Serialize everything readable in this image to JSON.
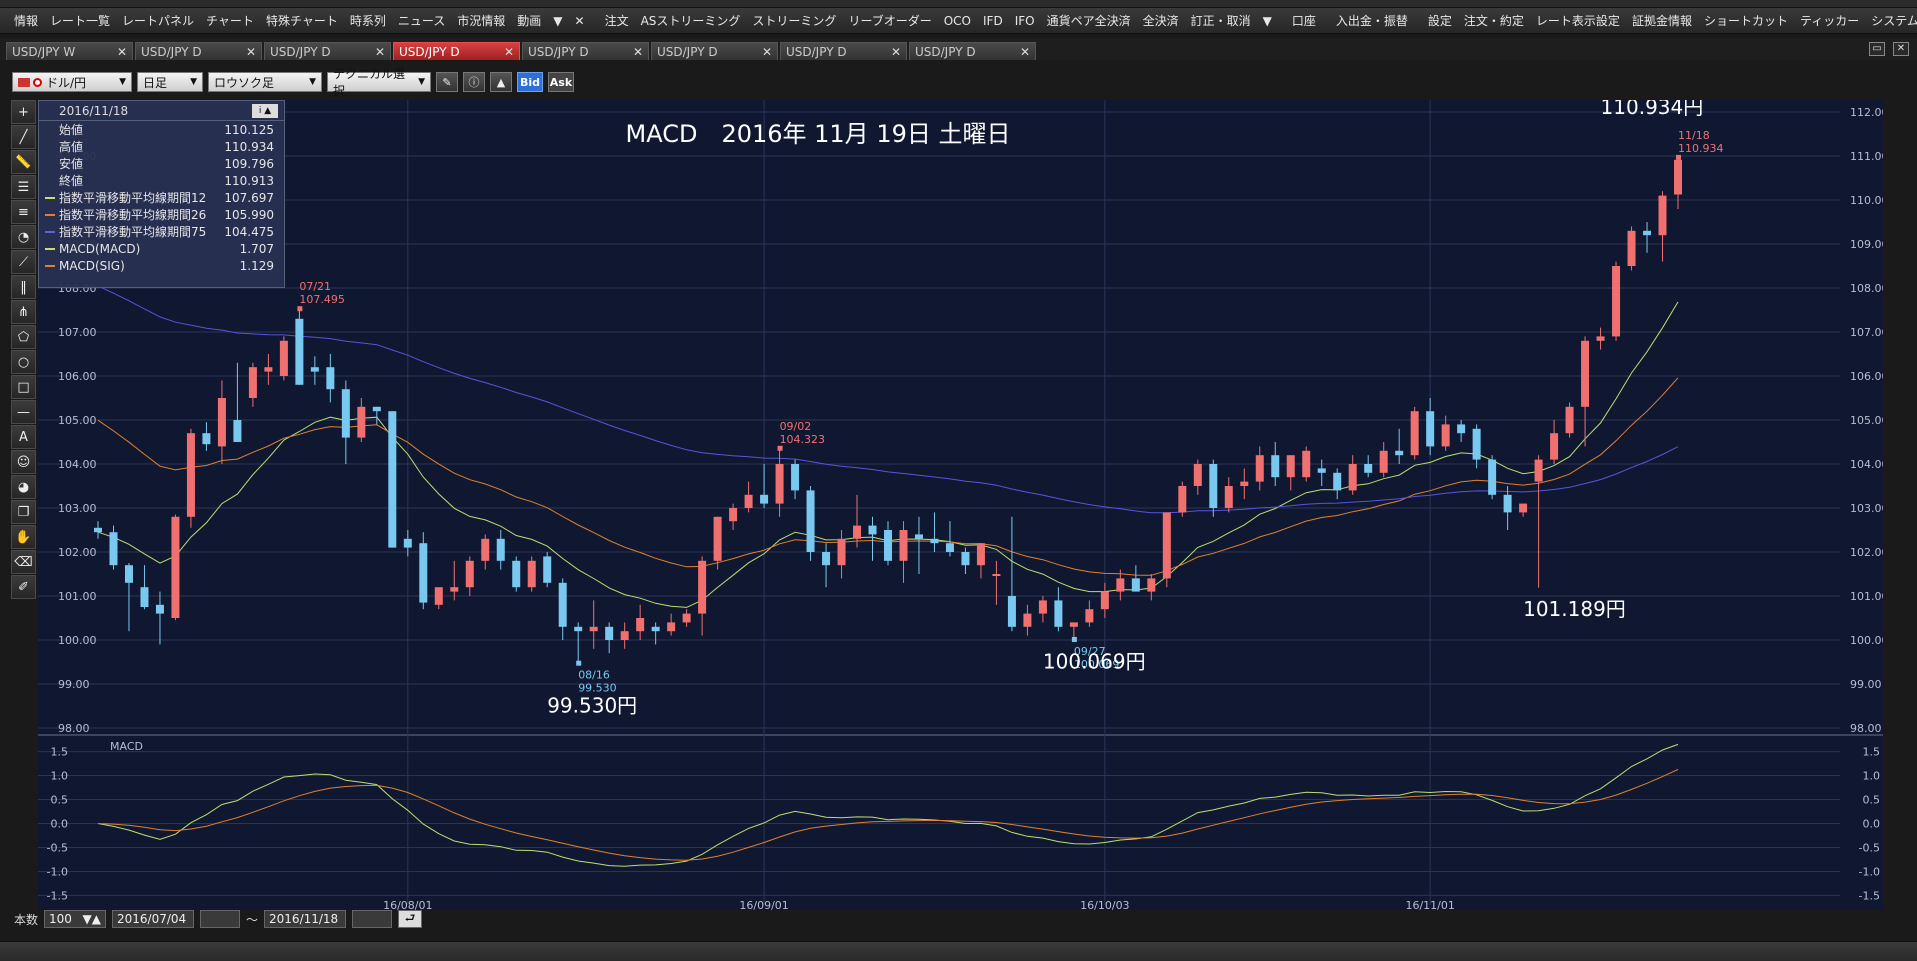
{
  "menubar": {
    "items": [
      "情報",
      "レート一覧",
      "レートパネル",
      "チャート",
      "特殊チャート",
      "時系列",
      "ニュース",
      "市況情報",
      "動画",
      "▼",
      "✕"
    ],
    "items2": [
      "注文",
      "ASストリーミング",
      "ストリーミング",
      "リーブオーダー",
      "OCO",
      "IFD",
      "IFO",
      "通貨ペア全決済",
      "全決済",
      "訂正・取消",
      "▼"
    ],
    "items3": [
      "口座"
    ],
    "items4": [
      "入出金・振替"
    ],
    "items5": [
      "設定",
      "注文・約定",
      "レート表示設定",
      "証拠金情報",
      "ショートカット",
      "ティッカー",
      "システム",
      "画面設定",
      "チャート"
    ]
  },
  "tabs": [
    {
      "label": "USD/JPY W",
      "active": false
    },
    {
      "label": "USD/JPY D",
      "active": false
    },
    {
      "label": "USD/JPY D",
      "active": false
    },
    {
      "label": "USD/JPY D",
      "active": true
    },
    {
      "label": "USD/JPY D",
      "active": false
    },
    {
      "label": "USD/JPY D",
      "active": false
    },
    {
      "label": "USD/JPY D",
      "active": false
    },
    {
      "label": "USD/JPY D",
      "active": false
    }
  ],
  "tab_close": "✕",
  "toolbar": {
    "pair": "ドル/円",
    "period": "日足",
    "style": "ロウソク足",
    "technical": "テクニカル選択",
    "bid": "Bid",
    "ask": "Ask"
  },
  "infopanel": {
    "date": "2016/11/18",
    "rows": [
      {
        "label": "始値",
        "value": "110.125",
        "color": ""
      },
      {
        "label": "高値",
        "value": "110.934",
        "color": ""
      },
      {
        "label": "安値",
        "value": "109.796",
        "color": ""
      },
      {
        "label": "終値",
        "value": "110.913",
        "color": ""
      },
      {
        "label": "指数平滑移動平均線期間12",
        "value": "107.697",
        "color": "#c8e060"
      },
      {
        "label": "指数平滑移動平均線期間26",
        "value": "105.990",
        "color": "#e08030"
      },
      {
        "label": "指数平滑移動平均線期間75",
        "value": "104.475",
        "color": "#6060e0"
      },
      {
        "label": "MACD(MACD)",
        "value": "1.707",
        "color": "#c8e060"
      },
      {
        "label": "MACD(SIG)",
        "value": "1.129",
        "color": "#e08030"
      }
    ]
  },
  "bottombar": {
    "count_label": "本数",
    "count_value": "100",
    "start": "2016/07/04",
    "tilde": "～",
    "end": "2016/11/18"
  },
  "chart_data": {
    "type": "candlestick",
    "title": "MACD　2016年 11月 19日 土曜日",
    "price_axis": {
      "min": 98,
      "max": 112,
      "ticks": [
        "112.00",
        "111.00",
        "110.00",
        "109.00",
        "108.00",
        "107.00",
        "106.00",
        "105.00",
        "104.00",
        "103.00",
        "102.00",
        "101.00",
        "100.00",
        "99.00",
        "98.00"
      ]
    },
    "macd_axis": {
      "min": -1.7,
      "max": 1.7,
      "ticks": [
        "1.5",
        "1.0",
        "0.5",
        "0.0",
        "-0.5",
        "-1.0",
        "-1.5"
      ]
    },
    "macd_label": "MACD",
    "date_ticks": [
      "16/08/01",
      "16/09/01",
      "16/10/03",
      "16/11/01"
    ],
    "candles": [
      {
        "date": "2016/07/04",
        "o": 102.55,
        "h": 102.7,
        "l": 102.3,
        "c": 102.45
      },
      {
        "date": "2016/07/05",
        "o": 102.45,
        "h": 102.6,
        "l": 101.6,
        "c": 101.7
      },
      {
        "date": "2016/07/06",
        "o": 101.7,
        "h": 101.75,
        "l": 100.2,
        "c": 101.3
      },
      {
        "date": "2016/07/07",
        "o": 101.2,
        "h": 101.7,
        "l": 100.7,
        "c": 100.75
      },
      {
        "date": "2016/07/08",
        "o": 100.8,
        "h": 101.1,
        "l": 99.9,
        "c": 100.6
      },
      {
        "date": "2016/07/11",
        "o": 100.5,
        "h": 102.85,
        "l": 100.45,
        "c": 102.8
      },
      {
        "date": "2016/07/12",
        "o": 102.8,
        "h": 104.8,
        "l": 102.55,
        "c": 104.7
      },
      {
        "date": "2016/07/13",
        "o": 104.7,
        "h": 104.95,
        "l": 104.3,
        "c": 104.45
      },
      {
        "date": "2016/07/14",
        "o": 104.4,
        "h": 105.9,
        "l": 104.0,
        "c": 105.5
      },
      {
        "date": "2016/07/15",
        "o": 105.0,
        "h": 106.3,
        "l": 104.8,
        "c": 104.5
      },
      {
        "date": "2016/07/18",
        "o": 105.5,
        "h": 106.3,
        "l": 105.3,
        "c": 106.2
      },
      {
        "date": "2016/07/19",
        "o": 106.1,
        "h": 106.5,
        "l": 105.8,
        "c": 106.2
      },
      {
        "date": "2016/07/20",
        "o": 106.0,
        "h": 106.9,
        "l": 105.9,
        "c": 106.8
      },
      {
        "date": "2016/07/21",
        "o": 107.3,
        "h": 107.495,
        "l": 105.8,
        "c": 105.8
      },
      {
        "date": "2016/07/22",
        "o": 106.2,
        "h": 106.45,
        "l": 105.8,
        "c": 106.1
      },
      {
        "date": "2016/07/25",
        "o": 106.2,
        "h": 106.5,
        "l": 105.4,
        "c": 105.7
      },
      {
        "date": "2016/07/26",
        "o": 105.7,
        "h": 105.9,
        "l": 104.0,
        "c": 104.6
      },
      {
        "date": "2016/07/27",
        "o": 104.6,
        "h": 105.5,
        "l": 104.5,
        "c": 105.3
      },
      {
        "date": "2016/07/28",
        "o": 105.3,
        "h": 105.3,
        "l": 104.9,
        "c": 105.2
      },
      {
        "date": "2016/07/29",
        "o": 105.2,
        "h": 105.2,
        "l": 102.1,
        "c": 102.1
      },
      {
        "date": "2016/08/01",
        "o": 102.3,
        "h": 102.5,
        "l": 101.9,
        "c": 102.1
      },
      {
        "date": "2016/08/02",
        "o": 102.2,
        "h": 102.45,
        "l": 100.7,
        "c": 100.85
      },
      {
        "date": "2016/08/03",
        "o": 100.8,
        "h": 101.0,
        "l": 100.7,
        "c": 101.2
      },
      {
        "date": "2016/08/04",
        "o": 101.1,
        "h": 101.8,
        "l": 100.9,
        "c": 101.2
      },
      {
        "date": "2016/08/05",
        "o": 101.2,
        "h": 101.9,
        "l": 101.0,
        "c": 101.8
      },
      {
        "date": "2016/08/08",
        "o": 101.8,
        "h": 102.4,
        "l": 101.6,
        "c": 102.3
      },
      {
        "date": "2016/08/09",
        "o": 102.3,
        "h": 102.5,
        "l": 101.6,
        "c": 101.8
      },
      {
        "date": "2016/08/10",
        "o": 101.8,
        "h": 101.9,
        "l": 101.1,
        "c": 101.2
      },
      {
        "date": "2016/08/11",
        "o": 101.2,
        "h": 101.9,
        "l": 101.1,
        "c": 101.8
      },
      {
        "date": "2016/08/12",
        "o": 101.9,
        "h": 102.0,
        "l": 101.2,
        "c": 101.3
      },
      {
        "date": "2016/08/15",
        "o": 101.3,
        "h": 101.4,
        "l": 100.0,
        "c": 100.3
      },
      {
        "date": "2016/08/16",
        "o": 100.3,
        "h": 100.4,
        "l": 99.53,
        "c": 100.2
      },
      {
        "date": "2016/08/17",
        "o": 100.2,
        "h": 100.9,
        "l": 99.8,
        "c": 100.3
      },
      {
        "date": "2016/08/18",
        "o": 100.3,
        "h": 100.4,
        "l": 99.7,
        "c": 100.0
      },
      {
        "date": "2016/08/19",
        "o": 100.0,
        "h": 100.4,
        "l": 99.8,
        "c": 100.2
      },
      {
        "date": "2016/08/22",
        "o": 100.2,
        "h": 100.8,
        "l": 100.0,
        "c": 100.5
      },
      {
        "date": "2016/08/23",
        "o": 100.3,
        "h": 100.4,
        "l": 99.9,
        "c": 100.2
      },
      {
        "date": "2016/08/24",
        "o": 100.2,
        "h": 100.6,
        "l": 100.1,
        "c": 100.4
      },
      {
        "date": "2016/08/25",
        "o": 100.4,
        "h": 100.7,
        "l": 100.3,
        "c": 100.6
      },
      {
        "date": "2016/08/26",
        "o": 100.6,
        "h": 101.9,
        "l": 100.1,
        "c": 101.8
      },
      {
        "date": "2016/08/29",
        "o": 101.8,
        "h": 102.8,
        "l": 101.6,
        "c": 102.8
      },
      {
        "date": "2016/08/30",
        "o": 102.7,
        "h": 103.1,
        "l": 102.5,
        "c": 103.0
      },
      {
        "date": "2016/08/31",
        "o": 103.0,
        "h": 103.6,
        "l": 102.9,
        "c": 103.3
      },
      {
        "date": "2016/09/01",
        "o": 103.3,
        "h": 104.0,
        "l": 103.0,
        "c": 103.1
      },
      {
        "date": "2016/09/02",
        "o": 103.1,
        "h": 104.323,
        "l": 102.8,
        "c": 104.0
      },
      {
        "date": "2016/09/05",
        "o": 104.0,
        "h": 104.1,
        "l": 103.2,
        "c": 103.4
      },
      {
        "date": "2016/09/06",
        "o": 103.4,
        "h": 103.5,
        "l": 101.8,
        "c": 102.0
      },
      {
        "date": "2016/09/07",
        "o": 102.0,
        "h": 102.2,
        "l": 101.2,
        "c": 101.7
      },
      {
        "date": "2016/09/08",
        "o": 101.7,
        "h": 102.5,
        "l": 101.4,
        "c": 102.3
      },
      {
        "date": "2016/09/09",
        "o": 102.3,
        "h": 103.3,
        "l": 102.1,
        "c": 102.6
      },
      {
        "date": "2016/09/12",
        "o": 102.6,
        "h": 102.8,
        "l": 101.8,
        "c": 102.4
      },
      {
        "date": "2016/09/13",
        "o": 102.5,
        "h": 102.7,
        "l": 101.7,
        "c": 101.8
      },
      {
        "date": "2016/09/14",
        "o": 101.8,
        "h": 102.7,
        "l": 101.3,
        "c": 102.5
      },
      {
        "date": "2016/09/15",
        "o": 102.4,
        "h": 102.8,
        "l": 101.5,
        "c": 102.3
      },
      {
        "date": "2016/09/16",
        "o": 102.3,
        "h": 102.9,
        "l": 102.0,
        "c": 102.2
      },
      {
        "date": "2016/09/19",
        "o": 102.2,
        "h": 102.7,
        "l": 101.9,
        "c": 102.0
      },
      {
        "date": "2016/09/20",
        "o": 102.0,
        "h": 102.1,
        "l": 101.5,
        "c": 101.7
      },
      {
        "date": "2016/09/21",
        "o": 101.7,
        "h": 102.2,
        "l": 101.4,
        "c": 102.2
      },
      {
        "date": "2016/09/22",
        "o": 101.5,
        "h": 101.8,
        "l": 100.8,
        "c": 101.5
      },
      {
        "date": "2016/09/23",
        "o": 101.0,
        "h": 102.8,
        "l": 100.2,
        "c": 100.3
      },
      {
        "date": "2016/09/26",
        "o": 100.3,
        "h": 100.8,
        "l": 100.1,
        "c": 100.6
      },
      {
        "date": "2016/09/27",
        "o": 100.6,
        "h": 101.0,
        "l": 100.4,
        "c": 100.9
      },
      {
        "date": "2016/09/28",
        "o": 100.9,
        "h": 101.2,
        "l": 100.2,
        "c": 100.3
      },
      {
        "date": "2016/09/29",
        "o": 100.3,
        "h": 100.4,
        "l": 100.069,
        "c": 100.4
      },
      {
        "date": "2016/09/30",
        "o": 100.4,
        "h": 100.9,
        "l": 100.3,
        "c": 100.7
      },
      {
        "date": "2016/10/03",
        "o": 100.7,
        "h": 101.3,
        "l": 100.5,
        "c": 101.1
      },
      {
        "date": "2016/10/04",
        "o": 101.1,
        "h": 101.6,
        "l": 100.9,
        "c": 101.4
      },
      {
        "date": "2016/10/05",
        "o": 101.4,
        "h": 101.7,
        "l": 101.2,
        "c": 101.1
      },
      {
        "date": "2016/10/06",
        "o": 101.1,
        "h": 101.5,
        "l": 100.9,
        "c": 101.4
      },
      {
        "date": "2016/10/07",
        "o": 101.4,
        "h": 102.9,
        "l": 101.2,
        "c": 102.9
      },
      {
        "date": "2016/10/10",
        "o": 102.9,
        "h": 103.6,
        "l": 102.8,
        "c": 103.5
      },
      {
        "date": "2016/10/11",
        "o": 103.5,
        "h": 104.1,
        "l": 103.3,
        "c": 104.0
      },
      {
        "date": "2016/10/12",
        "o": 104.0,
        "h": 104.1,
        "l": 102.8,
        "c": 103.0
      },
      {
        "date": "2016/10/13",
        "o": 103.0,
        "h": 103.7,
        "l": 102.9,
        "c": 103.5
      },
      {
        "date": "2016/10/14",
        "o": 103.5,
        "h": 103.9,
        "l": 103.2,
        "c": 103.6
      },
      {
        "date": "2016/10/17",
        "o": 103.6,
        "h": 104.4,
        "l": 103.4,
        "c": 104.2
      },
      {
        "date": "2016/10/18",
        "o": 104.2,
        "h": 104.5,
        "l": 103.5,
        "c": 103.7
      },
      {
        "date": "2016/10/19",
        "o": 103.7,
        "h": 104.2,
        "l": 103.4,
        "c": 104.2
      },
      {
        "date": "2016/10/20",
        "o": 103.7,
        "h": 104.4,
        "l": 103.6,
        "c": 104.3
      },
      {
        "date": "2016/10/21",
        "o": 103.9,
        "h": 104.1,
        "l": 103.5,
        "c": 103.8
      },
      {
        "date": "2016/10/24",
        "o": 103.8,
        "h": 103.9,
        "l": 103.2,
        "c": 103.4
      },
      {
        "date": "2016/10/25",
        "o": 103.4,
        "h": 104.2,
        "l": 103.3,
        "c": 104.0
      },
      {
        "date": "2016/10/26",
        "o": 104.0,
        "h": 104.2,
        "l": 103.7,
        "c": 103.8
      },
      {
        "date": "2016/10/27",
        "o": 103.8,
        "h": 104.5,
        "l": 103.7,
        "c": 104.3
      },
      {
        "date": "2016/10/28",
        "o": 104.3,
        "h": 104.8,
        "l": 104.0,
        "c": 104.2
      },
      {
        "date": "2016/10/31",
        "o": 104.2,
        "h": 105.3,
        "l": 104.1,
        "c": 105.2
      },
      {
        "date": "2016/11/01",
        "o": 105.2,
        "h": 105.5,
        "l": 104.2,
        "c": 104.4
      },
      {
        "date": "2016/11/02",
        "o": 104.4,
        "h": 105.1,
        "l": 104.3,
        "c": 104.9
      },
      {
        "date": "2016/11/03",
        "o": 104.9,
        "h": 105.0,
        "l": 104.5,
        "c": 104.7
      },
      {
        "date": "2016/11/04",
        "o": 104.8,
        "h": 104.9,
        "l": 103.9,
        "c": 104.1
      },
      {
        "date": "2016/11/07",
        "o": 104.1,
        "h": 104.2,
        "l": 103.2,
        "c": 103.3
      },
      {
        "date": "2016/11/08",
        "o": 103.3,
        "h": 103.5,
        "l": 102.5,
        "c": 102.9
      },
      {
        "date": "2016/11/09",
        "o": 102.9,
        "h": 103.1,
        "l": 102.8,
        "c": 103.1
      },
      {
        "date": "2016/11/10",
        "o": 103.6,
        "h": 104.2,
        "l": 101.189,
        "c": 104.1
      },
      {
        "date": "2016/11/11",
        "o": 104.1,
        "h": 105.0,
        "l": 104.0,
        "c": 104.7
      },
      {
        "date": "2016/11/14",
        "o": 104.7,
        "h": 105.4,
        "l": 104.6,
        "c": 105.3
      },
      {
        "date": "2016/11/15",
        "o": 105.3,
        "h": 106.9,
        "l": 104.4,
        "c": 106.8
      },
      {
        "date": "2016/11/16",
        "o": 106.8,
        "h": 107.1,
        "l": 106.6,
        "c": 106.9
      },
      {
        "date": "2016/11/17",
        "o": 106.9,
        "h": 108.6,
        "l": 106.8,
        "c": 108.5
      },
      {
        "date": "2016/11/18",
        "o": 108.5,
        "h": 109.4,
        "l": 108.4,
        "c": 109.3
      },
      {
        "date": "2016/11/21",
        "o": 109.3,
        "h": 109.5,
        "l": 108.8,
        "c": 109.2
      },
      {
        "date": "2016/11/22",
        "o": 109.2,
        "h": 110.2,
        "l": 108.6,
        "c": 110.1
      },
      {
        "date": "2016/11/23",
        "o": 110.125,
        "h": 110.934,
        "l": 109.796,
        "c": 110.913
      }
    ],
    "extreme_labels": [
      {
        "index": 13,
        "at": "high",
        "date": "07/21",
        "value": "107.495"
      },
      {
        "index": 31,
        "at": "low",
        "date": "08/16",
        "value": "99.530"
      },
      {
        "index": 44,
        "at": "high",
        "date": "09/02",
        "value": "104.323"
      },
      {
        "index": 63,
        "at": "low",
        "date": "09/27",
        "value": "100.069"
      },
      {
        "index": 102,
        "at": "high",
        "date": "11/18",
        "value": "110.934"
      }
    ],
    "big_annotations": [
      {
        "text": "110.934円",
        "index": 97,
        "price": 111.95
      },
      {
        "text": "99.530円",
        "index": 29,
        "price": 98.35
      },
      {
        "text": "100.069円",
        "index": 61,
        "price": 99.35
      },
      {
        "text": "101.189円",
        "index": 92,
        "price": 100.55
      }
    ],
    "ema_periods": [
      12,
      26,
      75
    ],
    "ema_colors": [
      "#b8e070",
      "#e08030",
      "#5555dd"
    ],
    "macd_colors": [
      "#b8e070",
      "#e08030"
    ],
    "up_color": "#f07070",
    "down_color": "#78c8f0"
  }
}
